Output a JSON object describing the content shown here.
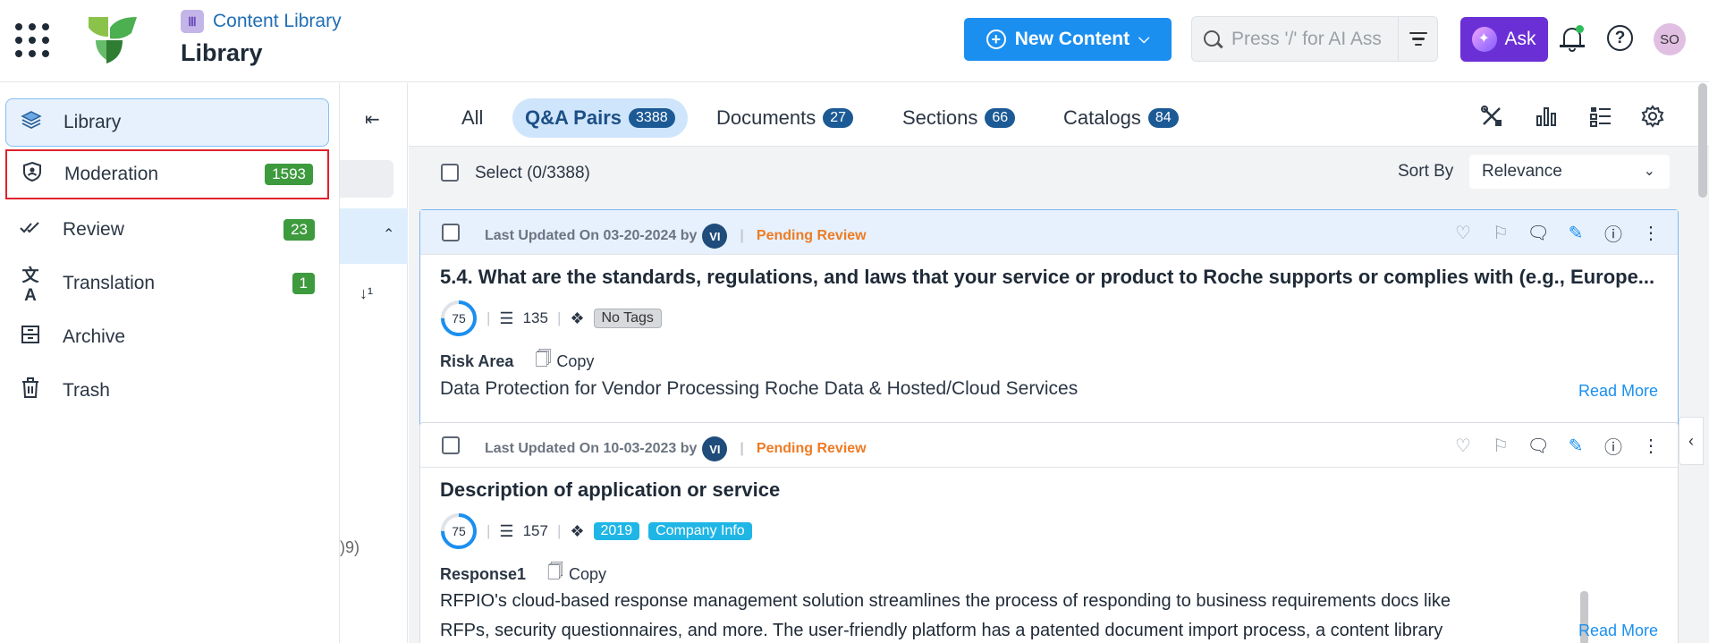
{
  "header": {
    "breadcrumb": "Content Library",
    "title": "Library",
    "new_content_label": "New Content",
    "search_placeholder": "Press '/' for AI Ass",
    "ask_label": "Ask",
    "avatar_initials": "SO"
  },
  "sidemenu": {
    "items": [
      {
        "label": "Library",
        "icon": "stack-icon"
      },
      {
        "label": "Moderation",
        "icon": "shield-user-icon",
        "badge": "1593"
      },
      {
        "label": "Review",
        "icon": "double-check-icon",
        "badge": "23"
      },
      {
        "label": "Translation",
        "icon": "translate-icon",
        "badge": "1"
      },
      {
        "label": "Archive",
        "icon": "archive-icon"
      },
      {
        "label": "Trash",
        "icon": "trash-icon"
      }
    ]
  },
  "midpanel": {
    "fragment": ")9)"
  },
  "tabs": [
    {
      "label": "All"
    },
    {
      "label": "Q&A Pairs",
      "count": "3388"
    },
    {
      "label": "Documents",
      "count": "27"
    },
    {
      "label": "Sections",
      "count": "66"
    },
    {
      "label": "Catalogs",
      "count": "84"
    }
  ],
  "toolbar": {
    "select_label": "Select (0/3388)",
    "sort_label": "Sort By",
    "sort_value": "Relevance"
  },
  "cards": [
    {
      "meta_prefix": "Last Updated On 03-20-2024 by",
      "user": "VI",
      "status": "Pending Review",
      "title": "5.4. What are the standards, regulations, and laws that your service or product to Roche supports or complies with (e.g., Europe...",
      "score": "75",
      "usage": "135",
      "tags": [
        "No Tags"
      ],
      "field_name": "Risk Area",
      "copy_label": "Copy",
      "answer": "Data Protection for Vendor Processing Roche Data & Hosted/Cloud Services",
      "read_more": "Read More"
    },
    {
      "meta_prefix": "Last Updated On 10-03-2023 by",
      "user": "VI",
      "status": "Pending Review",
      "title": "Description of application or service",
      "score": "75",
      "usage": "157",
      "tags": [
        "2019",
        "Company Info"
      ],
      "field_name": "Response1",
      "copy_label": "Copy",
      "answer_line1": "RFPIO's cloud-based response management solution streamlines the process of responding to business requirements docs like",
      "answer_line2": "RFPs, security questionnaires, and more. The user-friendly platform has a patented document import process, a content library",
      "read_more": "Read More"
    }
  ],
  "colors": {
    "primary": "#1b8ff0",
    "ask": "#6b2fd6",
    "badge": "#3d9a3d",
    "pending": "#ee7b24",
    "tag_blue": "#1fb6e6",
    "highlight": "#e1222b"
  }
}
